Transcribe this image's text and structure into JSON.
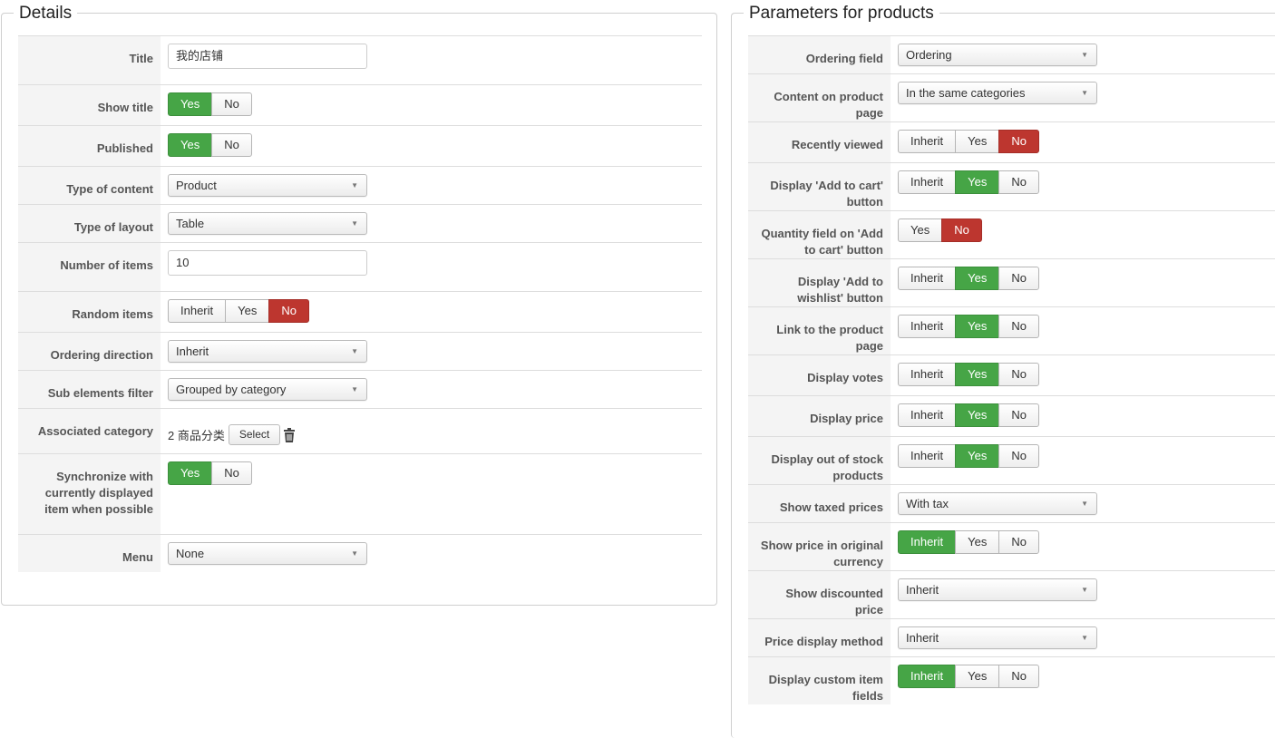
{
  "details": {
    "legend": "Details",
    "rows": {
      "title": {
        "label": "Title",
        "value": "我的店铺"
      },
      "show_title": {
        "label": "Show title",
        "options": [
          "Yes",
          "No"
        ]
      },
      "published": {
        "label": "Published",
        "options": [
          "Yes",
          "No"
        ]
      },
      "type_of_content": {
        "label": "Type of content",
        "value": "Product"
      },
      "type_of_layout": {
        "label": "Type of layout",
        "value": "Table"
      },
      "number_of_items": {
        "label": "Number of items",
        "value": "10"
      },
      "random_items": {
        "label": "Random items",
        "options": [
          "Inherit",
          "Yes",
          "No"
        ]
      },
      "ordering_direction": {
        "label": "Ordering direction",
        "value": "Inherit"
      },
      "sub_elements_filter": {
        "label": "Sub elements filter",
        "value": "Grouped by category"
      },
      "associated_category": {
        "label": "Associated category",
        "value": "2 商品分类",
        "button": "Select"
      },
      "synchronize": {
        "label": "Synchronize with currently displayed item when possible",
        "options": [
          "Yes",
          "No"
        ]
      },
      "menu": {
        "label": "Menu",
        "value": "None"
      }
    }
  },
  "params": {
    "legend": "Parameters for products",
    "rows": {
      "ordering_field": {
        "label": "Ordering field",
        "value": "Ordering"
      },
      "content_on_product_page": {
        "label": "Content on product page",
        "value": "In the same categories"
      },
      "recently_viewed": {
        "label": "Recently viewed",
        "options": [
          "Inherit",
          "Yes",
          "No"
        ]
      },
      "display_add_to_cart": {
        "label": "Display 'Add to cart' button",
        "options": [
          "Inherit",
          "Yes",
          "No"
        ]
      },
      "quantity_field": {
        "label": "Quantity field on 'Add to cart' button",
        "options": [
          "Yes",
          "No"
        ]
      },
      "display_add_to_wishlist": {
        "label": "Display 'Add to wishlist' button",
        "options": [
          "Inherit",
          "Yes",
          "No"
        ]
      },
      "link_to_product_page": {
        "label": "Link to the product page",
        "options": [
          "Inherit",
          "Yes",
          "No"
        ]
      },
      "display_votes": {
        "label": "Display votes",
        "options": [
          "Inherit",
          "Yes",
          "No"
        ]
      },
      "display_price": {
        "label": "Display price",
        "options": [
          "Inherit",
          "Yes",
          "No"
        ]
      },
      "display_out_of_stock": {
        "label": "Display out of stock products",
        "options": [
          "Inherit",
          "Yes",
          "No"
        ]
      },
      "show_taxed_prices": {
        "label": "Show taxed prices",
        "value": "With tax"
      },
      "show_price_original_currency": {
        "label": "Show price in original currency",
        "options": [
          "Inherit",
          "Yes",
          "No"
        ]
      },
      "show_discounted_price": {
        "label": "Show discounted price",
        "value": "Inherit"
      },
      "price_display_method": {
        "label": "Price display method",
        "value": "Inherit"
      },
      "display_custom_item_fields": {
        "label": "Display custom item fields",
        "options": [
          "Inherit",
          "Yes",
          "No"
        ]
      }
    }
  },
  "colors": {
    "yes_active": "#46a546",
    "no_active": "#bd362f"
  }
}
